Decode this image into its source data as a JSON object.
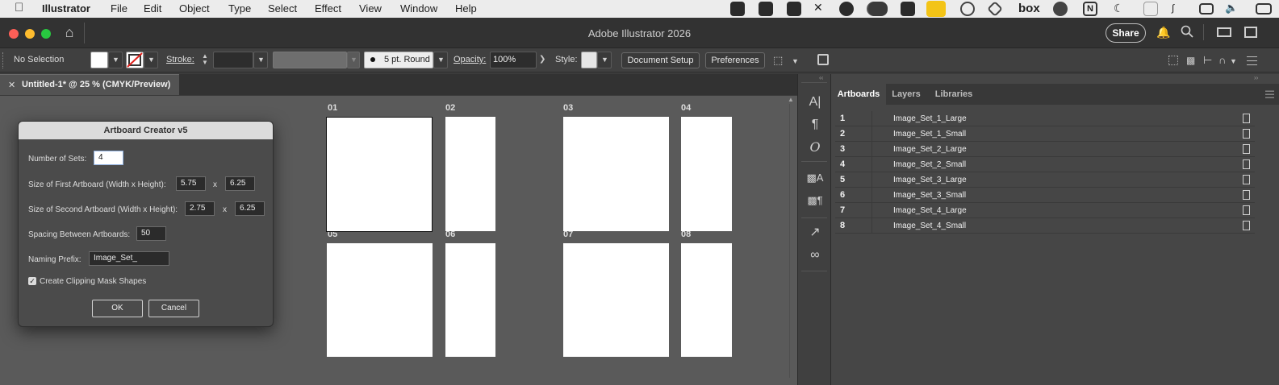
{
  "menubar": {
    "app": "Illustrator",
    "items": [
      "File",
      "Edit",
      "Object",
      "Type",
      "Select",
      "Effect",
      "View",
      "Window",
      "Help"
    ]
  },
  "window": {
    "title": "Adobe Illustrator 2026",
    "share_label": "Share"
  },
  "control_bar": {
    "selection": "No Selection",
    "stroke_label": "Stroke:",
    "brush_label": "5 pt. Round",
    "opacity_label": "Opacity:",
    "opacity_value": "100%",
    "style_label": "Style:",
    "document_setup": "Document Setup",
    "preferences": "Preferences"
  },
  "document_tab": {
    "label": "Untitled-1* @ 25 % (CMYK/Preview)"
  },
  "artboards": [
    {
      "label": "01"
    },
    {
      "label": "02"
    },
    {
      "label": "03"
    },
    {
      "label": "04"
    },
    {
      "label": "05"
    },
    {
      "label": "06"
    },
    {
      "label": "07"
    },
    {
      "label": "08"
    }
  ],
  "dialog": {
    "title": "Artboard Creator v5",
    "sets_label": "Number of Sets:",
    "sets_value": "4",
    "first_label": "Size of First Artboard (Width x Height):",
    "first_w": "5.75",
    "first_h": "6.25",
    "second_label": "Size of Second Artboard (Width x Height):",
    "second_w": "2.75",
    "second_h": "6.25",
    "x_sep": "x",
    "spacing_label": "Spacing Between Artboards:",
    "spacing_value": "50",
    "prefix_label": "Naming Prefix:",
    "prefix_value": "Image_Set_",
    "clip_label": "Create Clipping Mask Shapes",
    "clip_checked": true,
    "ok": "OK",
    "cancel": "Cancel"
  },
  "panel": {
    "tabs": [
      "Artboards",
      "Layers",
      "Libraries"
    ],
    "active_tab": "Artboards",
    "rows": [
      {
        "num": "1",
        "name": "Image_Set_1_Large"
      },
      {
        "num": "2",
        "name": "Image_Set_1_Small"
      },
      {
        "num": "3",
        "name": "Image_Set_2_Large"
      },
      {
        "num": "4",
        "name": "Image_Set_2_Small"
      },
      {
        "num": "5",
        "name": "Image_Set_3_Large"
      },
      {
        "num": "6",
        "name": "Image_Set_3_Small"
      },
      {
        "num": "7",
        "name": "Image_Set_4_Large"
      },
      {
        "num": "8",
        "name": "Image_Set_4_Small"
      }
    ]
  },
  "tray": {
    "box_label": "box",
    "notion_label": "N"
  }
}
